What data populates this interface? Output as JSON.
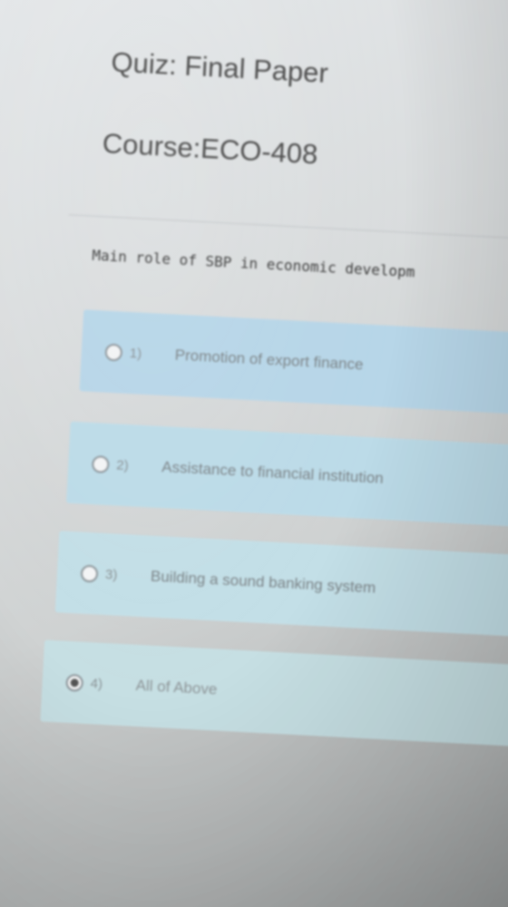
{
  "header": {
    "quiz_title": "Quiz: Final Paper",
    "course_title": "Course:ECO-408"
  },
  "question": {
    "text": "Main role of SBP in economic developm"
  },
  "options": [
    {
      "number": "1)",
      "label": "Promotion of export finance",
      "selected": false
    },
    {
      "number": "2)",
      "label": "Assistance to financial institution",
      "selected": false
    },
    {
      "number": "3)",
      "label": "Building a sound banking system",
      "selected": false
    },
    {
      "number": "4)",
      "label": "All of Above",
      "selected": true
    }
  ],
  "colors": {
    "option_bg": "#b7d6e8",
    "text": "#4a4a4a"
  }
}
